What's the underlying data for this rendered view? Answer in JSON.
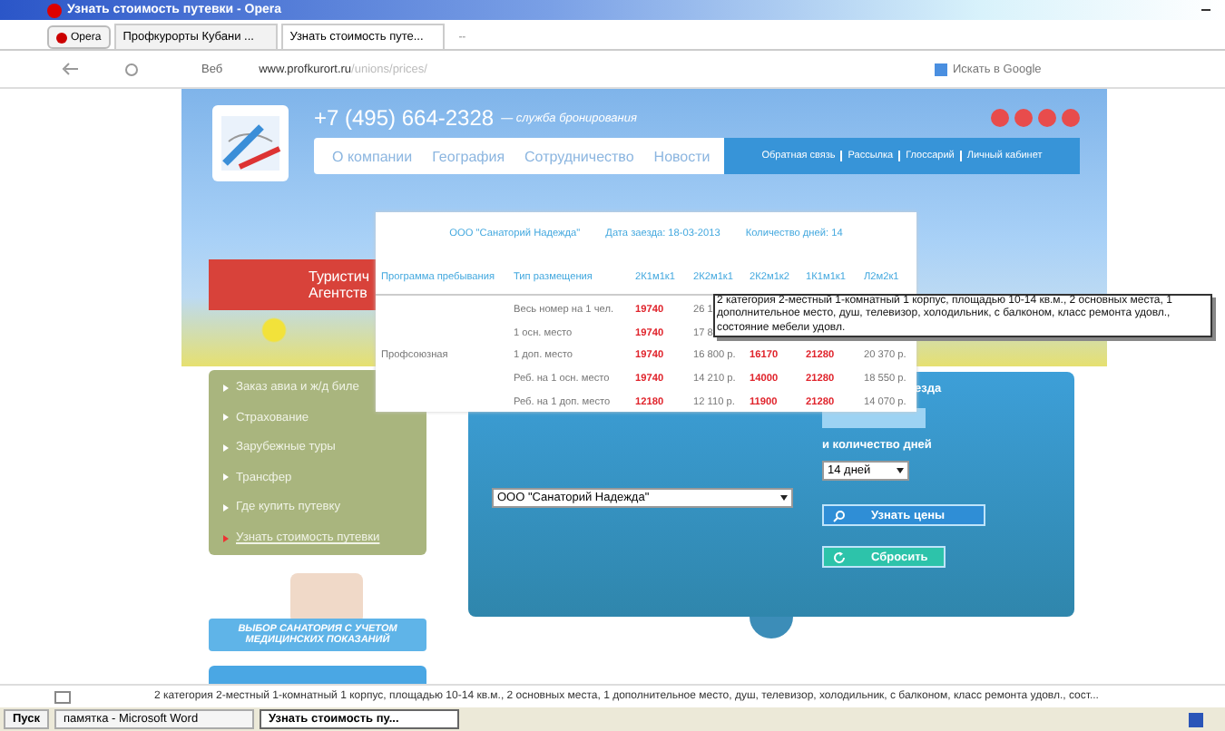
{
  "window": {
    "title": "Узнать стоимость путевки - Opera"
  },
  "browser": {
    "menu_button": "Opera",
    "tabs": [
      {
        "label": "Профкурорты Кубани ...",
        "selected": false
      },
      {
        "label": "Узнать стоимость путе...",
        "selected": true
      }
    ],
    "new_tab": "--",
    "web_label": "Веб",
    "address": {
      "host": "www.profkurort.ru",
      "path": "/unions/prices/"
    },
    "search": {
      "placeholder": "Искать в Google"
    }
  },
  "header": {
    "phone": "+7 (495) 664-2328",
    "phone_note": "— служба бронирования",
    "nav": [
      {
        "label": "О компании"
      },
      {
        "label": "География"
      },
      {
        "label": "Сотрудничество"
      },
      {
        "label": "Новости"
      }
    ],
    "links": [
      "Обратная связь",
      "Рассылка",
      "Глоссарий",
      "Личный кабинет"
    ],
    "banner": [
      "Туристич",
      "Агентств"
    ]
  },
  "popup": {
    "info": [
      "ООО \"Санаторий Надежда\"",
      "Дата заезда: 18-03-2013",
      "Количество дней: 14"
    ],
    "columns": [
      "Программа пребывания",
      "Тип размещения",
      "2К1м1к1",
      "2К2м1к1",
      "2К2м1к2",
      "1К1м1к1",
      "Л2м2к1"
    ],
    "rows": [
      {
        "cells": [
          {
            "text": ""
          },
          {
            "text": "Весь номер на 1 чел.",
            "highlight": false
          },
          {
            "text": "19740",
            "highlight": true
          },
          {
            "text": "26 1",
            "highlight": false
          }
        ]
      },
      {
        "cells": [
          {
            "text": ""
          },
          {
            "text": "1 осн. место",
            "highlight": false
          },
          {
            "text": "19740",
            "highlight": true
          },
          {
            "text": "17 8",
            "highlight": false
          }
        ]
      },
      {
        "cells": [
          {
            "text": "Профсоюзная",
            "highlight": false
          },
          {
            "text": "1 доп. место",
            "highlight": false
          },
          {
            "text": "19740",
            "highlight": true
          },
          {
            "text": "16 800 р.",
            "highlight": false
          },
          {
            "text": "16170",
            "highlight": true
          },
          {
            "text": "21280",
            "highlight": true
          },
          {
            "text": "20 370 р.",
            "highlight": false
          }
        ]
      },
      {
        "cells": [
          {
            "text": ""
          },
          {
            "text": "Реб. на 1 осн. место",
            "highlight": false
          },
          {
            "text": "19740",
            "highlight": true
          },
          {
            "text": "14 210 р.",
            "highlight": false
          },
          {
            "text": "14000",
            "highlight": true
          },
          {
            "text": "21280",
            "highlight": true
          },
          {
            "text": "18 550 р.",
            "highlight": false
          }
        ]
      },
      {
        "cells": [
          {
            "text": ""
          },
          {
            "text": "Реб. на 1 доп. место",
            "highlight": false
          },
          {
            "text": "12180",
            "highlight": true
          },
          {
            "text": "12 110 р.",
            "highlight": false
          },
          {
            "text": "11900",
            "highlight": true
          },
          {
            "text": "21280",
            "highlight": true
          },
          {
            "text": "14 070 р.",
            "highlight": false
          }
        ]
      }
    ]
  },
  "tooltip": "2 категория 2-местный 1-комнатный 1 корпус, площадью 10-14 кв.м., 2 основных  места, 1 дополнительное место, душ, телевизор, холодильник, с балконом, класс ремонта удовл., состояние мебели удовл.",
  "sidebar": {
    "items": [
      {
        "label": "Заказ авиа и ж/д биле",
        "selected": false
      },
      {
        "label": "Страхование",
        "selected": false
      },
      {
        "label": "Зарубежные туры",
        "selected": false
      },
      {
        "label": "Трансфер",
        "selected": false
      },
      {
        "label": "Где купить путевку",
        "selected": false
      },
      {
        "label": "Узнать стоимость путевки",
        "selected": true
      }
    ],
    "ad": "ВЫБОР САНАТОРИЯ С УЧЕТОМ МЕДИЦИНСКИХ ПОКАЗАНИЙ"
  },
  "form": {
    "date_label": "езда",
    "days_label": "и количество дней",
    "days": "14 дней",
    "sanatorium": "ООО \"Санаторий Надежда\"",
    "buttons": [
      {
        "kind": "search",
        "label": "Узнать цены"
      },
      {
        "kind": "reset",
        "label": "Сбросить"
      }
    ]
  },
  "status_bar": "2 категория 2-местный 1-комнатный 1 корпус, площадью 10-14 кв.м., 2 основных  места, 1 дополнительное место, душ, телевизор, холодильник, с балконом, класс ремонта удовл., сост...",
  "taskbar": {
    "start": "Пуск",
    "tasks": [
      {
        "label": "памятка - Microsoft Word",
        "selected": false
      },
      {
        "label": "Узнать стоимость пу...",
        "selected": true
      }
    ]
  }
}
